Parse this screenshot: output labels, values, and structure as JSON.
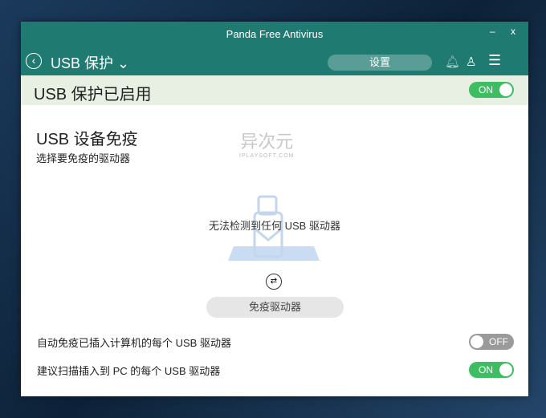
{
  "window": {
    "title": "Panda Free Antivirus",
    "minimize": "–",
    "close": "x"
  },
  "nav": {
    "section": "USB 保护",
    "settings": "设置"
  },
  "header": {
    "title": "USB 保护已启用",
    "toggle": "ON"
  },
  "main": {
    "title": "USB 设备免疫",
    "subtitle": "选择要免疫的驱动器",
    "empty_message": "无法检测到任何 USB 驱动器",
    "immunize_button": "免疫驱动器"
  },
  "watermark": {
    "name": "异次元",
    "site": "IPLAYSOFT.COM"
  },
  "options": [
    {
      "label": "自动免疫已插入计算机的每个 USB 驱动器",
      "toggle": "OFF"
    },
    {
      "label": "建议扫描插入到 PC 的每个 USB 驱动器",
      "toggle": "ON"
    }
  ]
}
